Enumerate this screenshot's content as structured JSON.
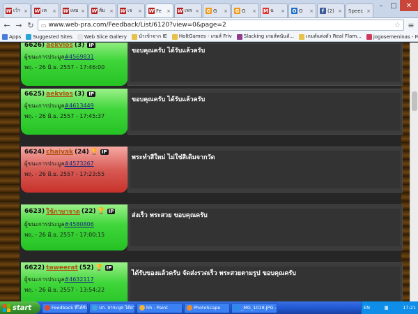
{
  "browser": {
    "tabs": [
      {
        "icon": "w",
        "label": "เว้า"
      },
      {
        "icon": "w",
        "label": "เห"
      },
      {
        "icon": "w",
        "label": "เหม"
      },
      {
        "icon": "w",
        "label": "ส้ม"
      },
      {
        "icon": "w",
        "label": "เจ"
      },
      {
        "icon": "w",
        "label": "Fe",
        "active": true
      },
      {
        "icon": "w",
        "label": "เพร"
      },
      {
        "icon": "g",
        "label": "G"
      },
      {
        "icon": "g",
        "label": "G"
      },
      {
        "icon": "m",
        "label": "ฉ"
      },
      {
        "icon": "o",
        "label": "O"
      },
      {
        "icon": "f",
        "label": "(2)"
      },
      {
        "icon": "none",
        "label": "Speec"
      }
    ],
    "url": "www.web-pra.com/Feedback/List/6120?view=0&page=2",
    "bookmarks": [
      {
        "label": "Apps",
        "color": "#4a7ad8"
      },
      {
        "label": "Suggested Sites",
        "color": "#2aa3d8"
      },
      {
        "label": "Web Slice Gallery",
        "color": "#e5e5e5"
      },
      {
        "label": "นำเข้าจาก IE",
        "color": "#e7c14a"
      },
      {
        "label": "HoltGames - เกมส์ Friv",
        "color": "#e7c14a"
      },
      {
        "label": "Slacking เกมส์พนันลั...",
        "color": "#8d3c8f"
      },
      {
        "label": "เกมส์แต่งตัว Real Flam...",
        "color": "#e7c14a"
      },
      {
        "label": "jogosemeninas - Maid ...",
        "color": "#d03a5a"
      }
    ]
  },
  "feedback": [
    {
      "number": "6626)",
      "user": "aekvios",
      "score": "(3)",
      "type": "positive",
      "trophy": "none",
      "auction_label": "ผู้ขนะการประมูล",
      "auction_id": "#4569831",
      "date": "พฤ. - 26 มิ.ย. 2557 - 17:46:00",
      "message": "ขอบคุณครับ ได้รับแล้วครับ"
    },
    {
      "number": "6625)",
      "user": "aekvios",
      "score": "(3)",
      "type": "positive",
      "trophy": "none",
      "auction_label": "ผู้ขนะการประมูล",
      "auction_id": "#4613449",
      "date": "พฤ. - 26 มิ.ย. 2557 - 17:45:37",
      "message": "ขอบคุณครับ ได้รับแล้วครับ"
    },
    {
      "number": "6624)",
      "user": "chaiyak",
      "score": "(24)",
      "type": "negative",
      "trophy": "silver",
      "auction_label": "ผู้ขนะการประมูล",
      "auction_id": "#4573267",
      "date": "พฤ. - 26 มิ.ย. 2557 - 17:23:55",
      "message": "พระทำสีใหม่ ไม่ใช่สีเดิมจากวัด"
    },
    {
      "number": "6623)",
      "user": "ใช้ภาษาจาด",
      "score": "(22)",
      "type": "positive",
      "trophy": "silver",
      "auction_label": "ผู้ขนะการประมูล",
      "auction_id": "#4580806",
      "date": "พฤ. - 26 มิ.ย. 2557 - 17:00:15",
      "message": "ส่งเร็ว พระสวย ขอบคุณครับ"
    },
    {
      "number": "6622)",
      "user": "taweerat",
      "score": "(52)",
      "type": "positive",
      "trophy": "gold",
      "auction_label": "ผู้ขนะการประมูล",
      "auction_id": "#4632117",
      "date": "พฤ. - 26 มิ.ย. 2557 - 13:54:22",
      "message": "ได้รับของแล้วครับ จัดส่งรวดเร็ว พระสวยตามรูป ขอบคุณครับ"
    }
  ],
  "ip_badge": "IP",
  "taskbar": {
    "start_label": "start",
    "tasks": [
      {
        "label": "Feedback ที่ได้รับจ...",
        "color": "#e34a2f"
      },
      {
        "label": "บก. ลาระบุค ได้ฝากเกิน...",
        "color": "#3fa3e3"
      },
      {
        "label": "hh - Paint",
        "color": "#f3b23a"
      },
      {
        "label": "PhotoScape",
        "color": "#f08c2a"
      },
      {
        "label": "_MG_1019.JPG - Pho...",
        "color": "#2a8ee8"
      }
    ],
    "lang": "EN",
    "clock": "17:21"
  }
}
